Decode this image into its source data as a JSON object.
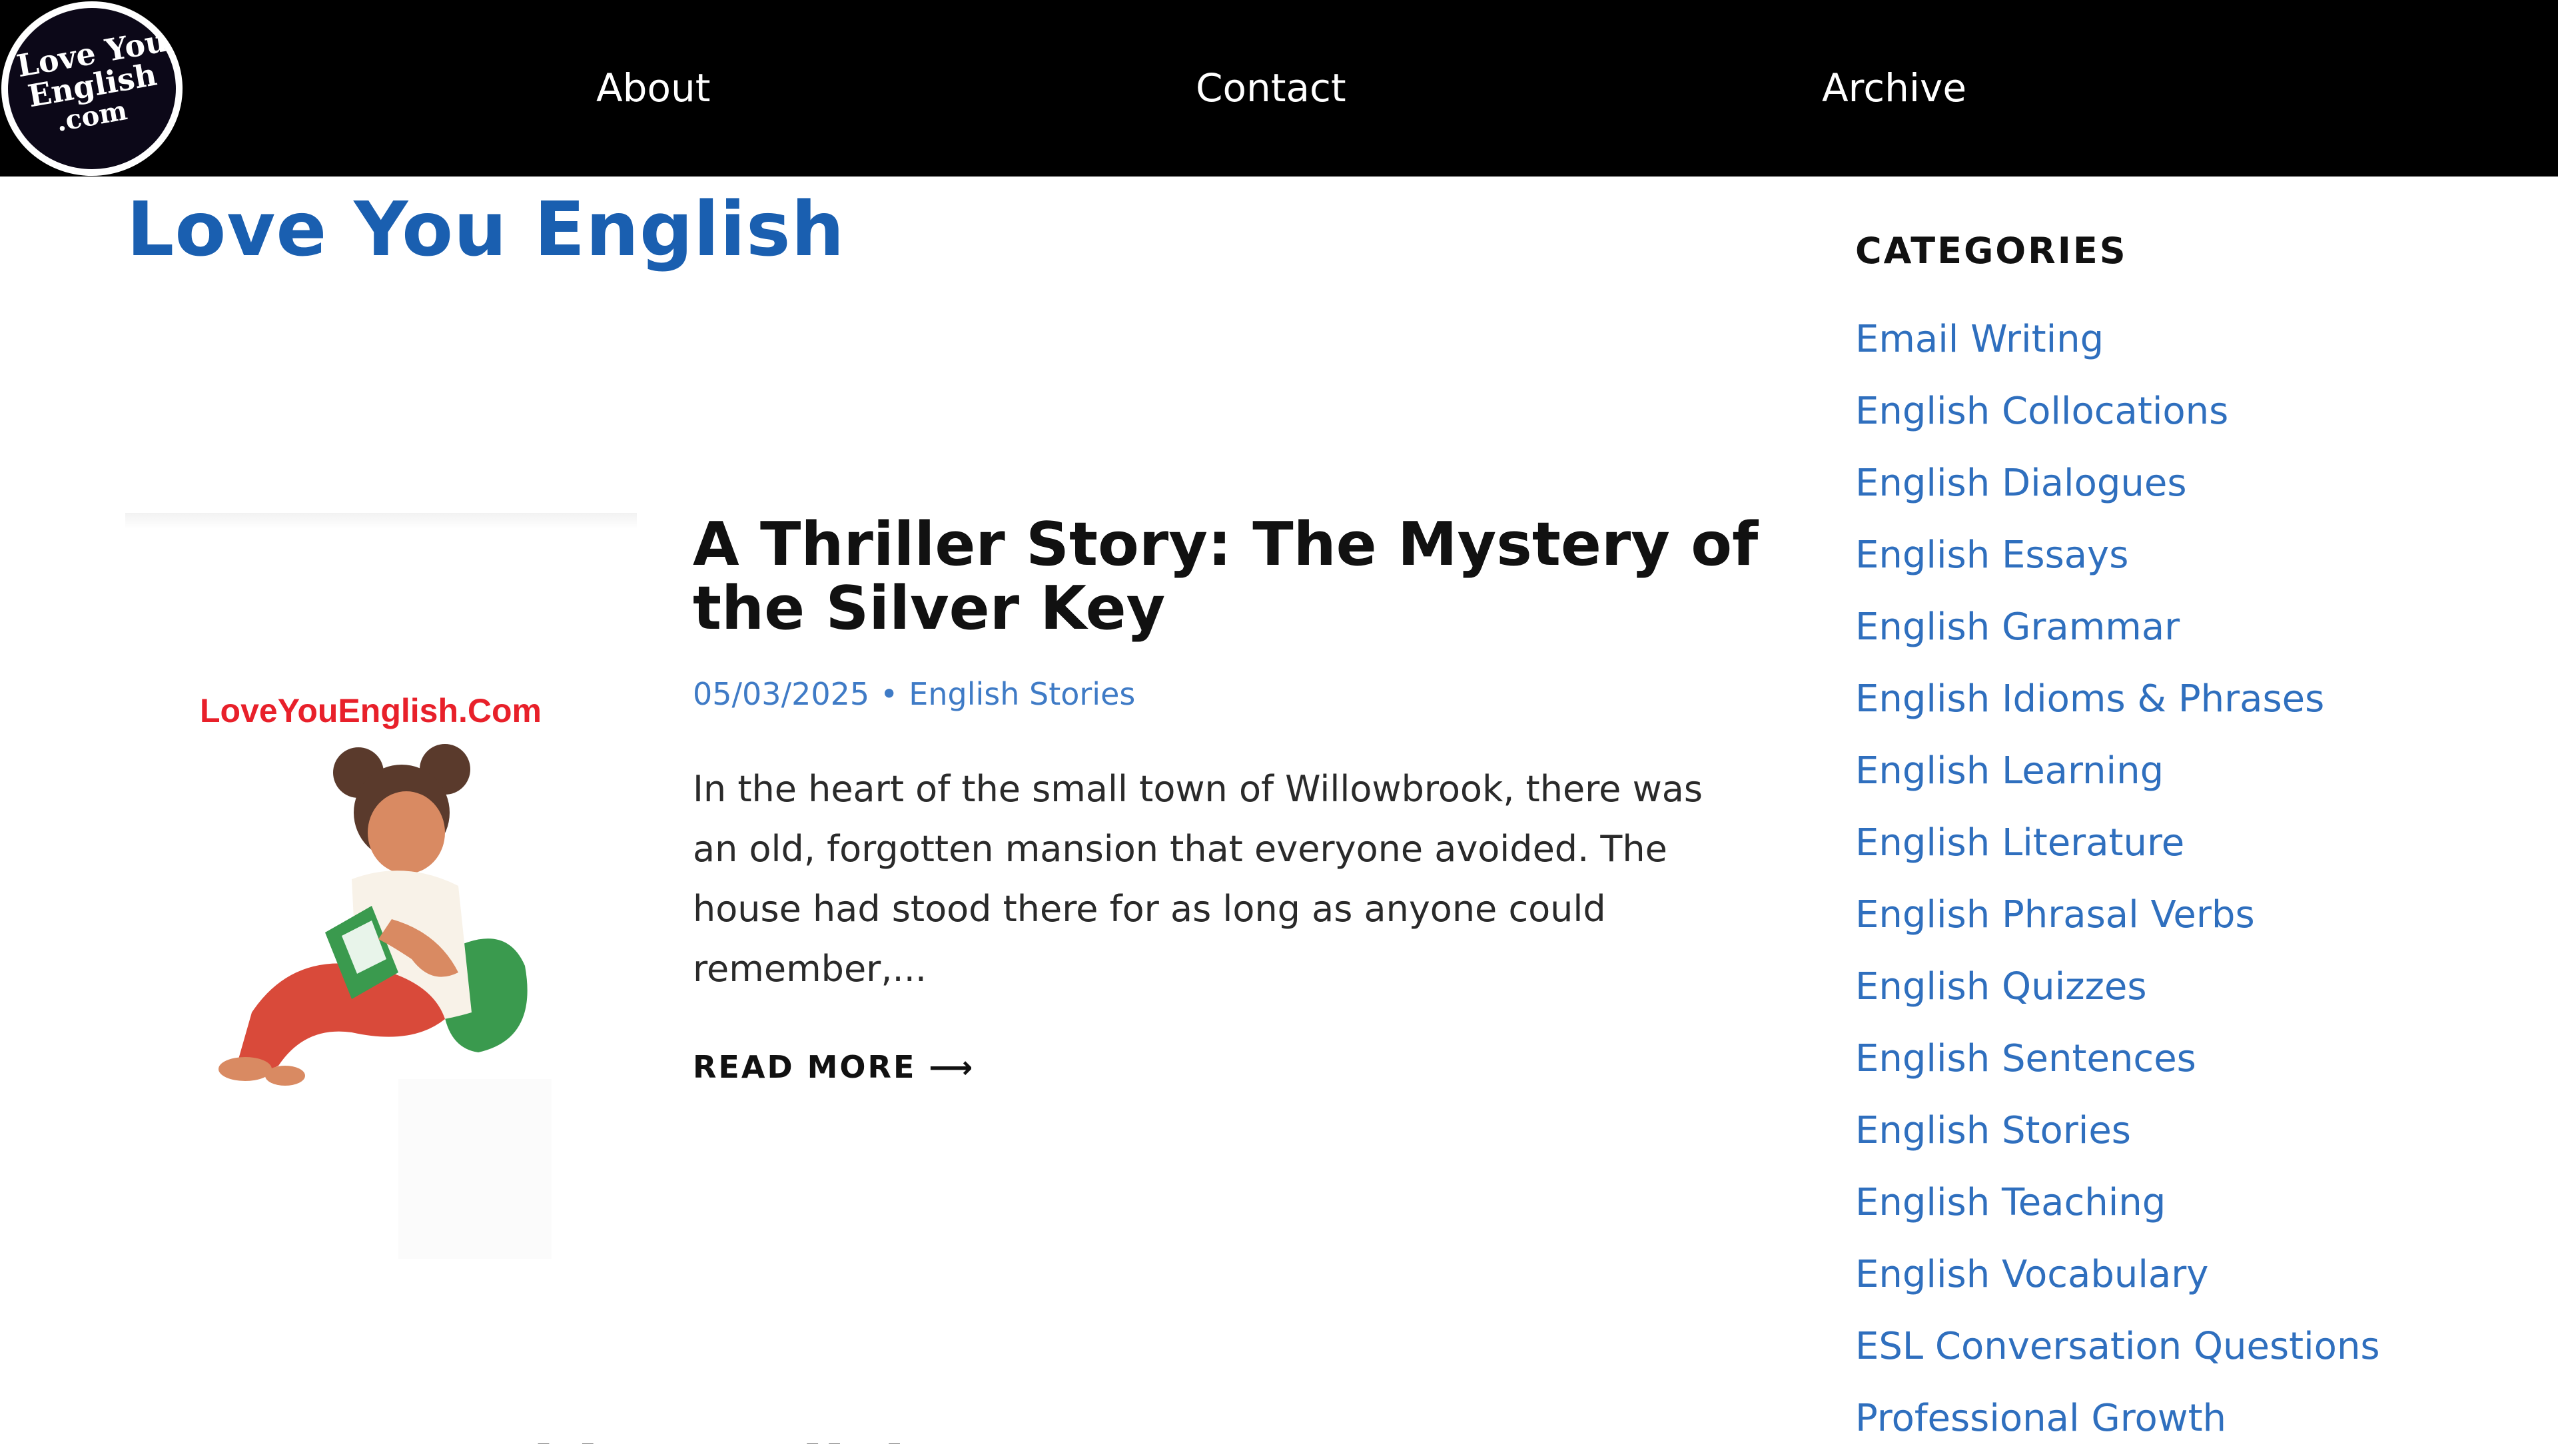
{
  "header": {
    "logo": {
      "line1": "Love You",
      "line2": "English",
      "line3": ".com"
    },
    "nav": [
      {
        "label": "About"
      },
      {
        "label": "Contact"
      },
      {
        "label": "Archive"
      }
    ]
  },
  "site": {
    "title": "Love You English"
  },
  "post": {
    "thumbnail_brand": "LoveYouEnglish.Com",
    "title": "A Thriller Story: The Mystery of the Silver Key",
    "date": "05/03/2025",
    "separator": "•",
    "category": "English Stories",
    "excerpt": "In the heart of the small town of Willowbrook, there was an old, forgotten mansion that everyone avoided. The house had stood there for as long as anyone could remember,...",
    "read_more": "READ MORE ⟶"
  },
  "sidebar": {
    "heading": "CATEGORIES",
    "categories": [
      "Email Writing",
      "English Collocations",
      "English Dialogues",
      "English Essays",
      "English Grammar",
      "English Idioms & Phrases",
      "English Learning",
      "English Literature",
      "English Phrasal Verbs",
      "English Quizzes",
      "English Sentences",
      "English Stories",
      "English Teaching",
      "English Vocabulary",
      "ESL Conversation Questions",
      "Professional Growth"
    ]
  },
  "next_post": {
    "title_partial": "Nouns Used in English"
  },
  "colors": {
    "header_bg": "#000000",
    "brand_blue": "#1a5fb0",
    "link_blue": "#2f6fbe",
    "thumbnail_brand_red": "#e8202a"
  }
}
